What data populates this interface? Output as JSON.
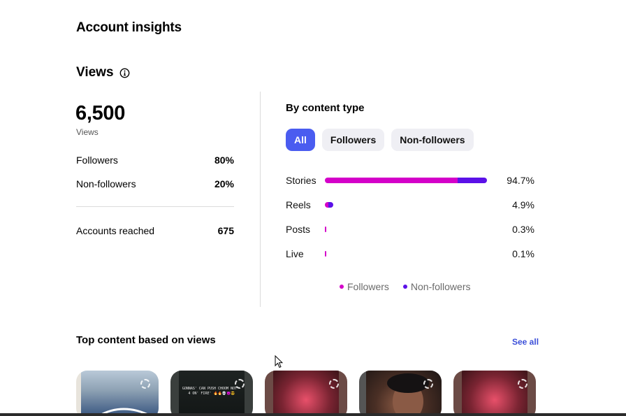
{
  "page": {
    "title": "Account insights"
  },
  "views": {
    "heading": "Views",
    "total": "6,500",
    "total_label": "Views",
    "followers_label": "Followers",
    "followers_pct": "80%",
    "nonfollowers_label": "Non-followers",
    "nonfollowers_pct": "20%",
    "accounts_reached_label": "Accounts reached",
    "accounts_reached_value": "675"
  },
  "by_content_type": {
    "title": "By content type",
    "tabs": [
      {
        "label": "All",
        "active": true
      },
      {
        "label": "Followers",
        "active": false
      },
      {
        "label": "Non-followers",
        "active": false
      }
    ],
    "rows": [
      {
        "name": "Stories",
        "pct": "94.7%",
        "share": 0.947,
        "followers_share": 0.82
      },
      {
        "name": "Reels",
        "pct": "4.9%",
        "share": 0.049,
        "followers_share": 0.4
      },
      {
        "name": "Posts",
        "pct": "0.3%",
        "share": 0.003,
        "followers_share": 1.0
      },
      {
        "name": "Live",
        "pct": "0.1%",
        "share": 0.001,
        "followers_share": 1.0
      }
    ],
    "legend": {
      "followers": "Followers",
      "nonfollowers": "Non-followers"
    },
    "colors": {
      "followers": "#d400c9",
      "nonfollowers": "#5b11e8",
      "active_tab": "#4a5cf0"
    }
  },
  "top_content": {
    "title": "Top content based on views",
    "see_all": "See all",
    "thumb2_caption": "GONNAS' CAN PUSH CHOOM NOT - 4 ON' FIRE' 🔥🔥💀😈😎"
  }
}
